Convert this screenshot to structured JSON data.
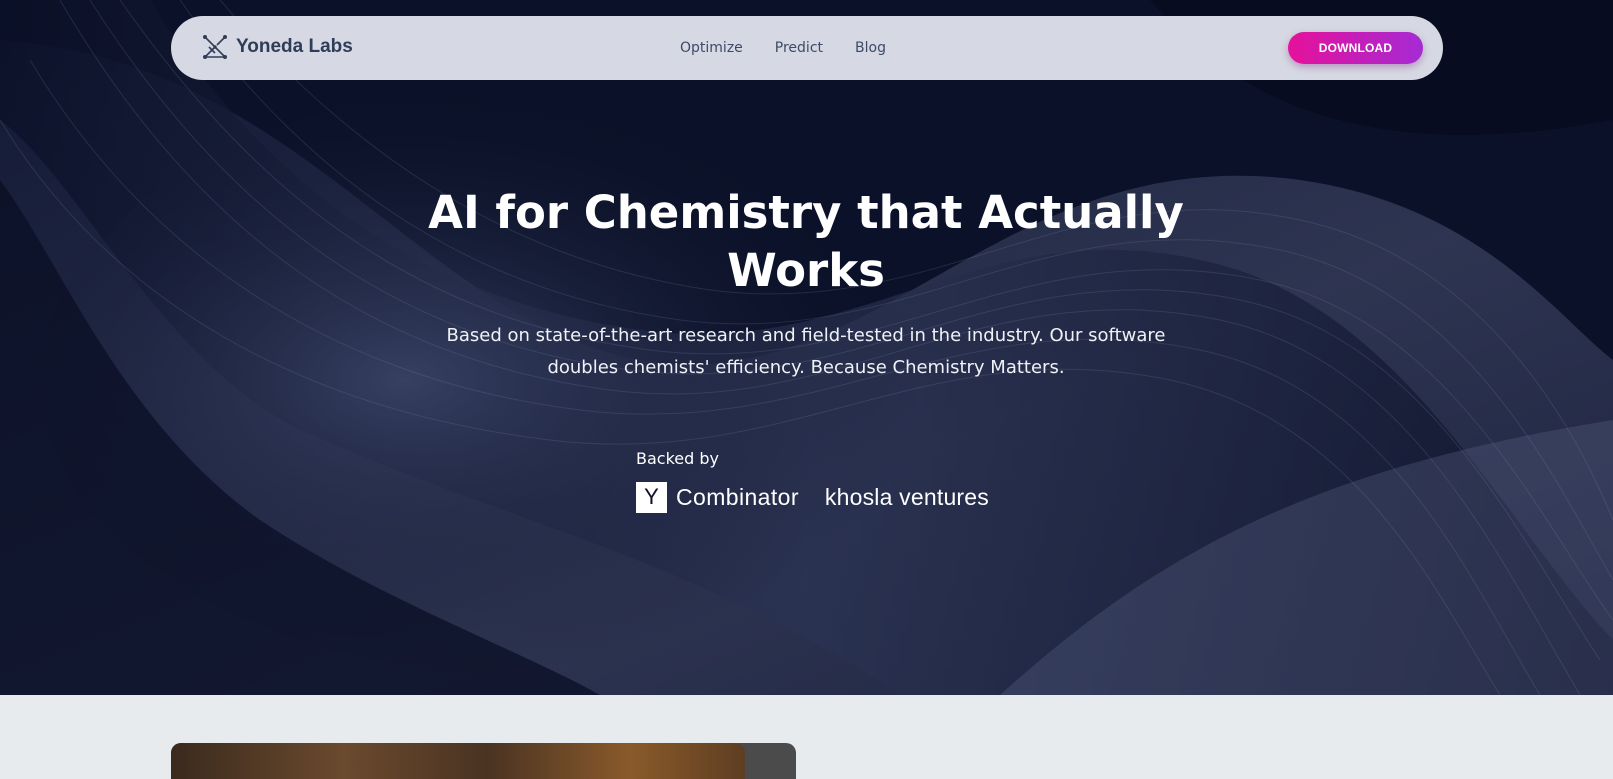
{
  "brand": {
    "name": "Yoneda Labs",
    "logo_icon": "graph-network-icon"
  },
  "nav": {
    "links": [
      {
        "label": "Optimize"
      },
      {
        "label": "Predict"
      },
      {
        "label": "Blog"
      }
    ],
    "download_label": "DOWNLOAD"
  },
  "hero": {
    "title": "AI for Chemistry that Actually Works",
    "subtitle": "Based on state-of-the-art research and field-tested in the industry. Our software doubles chemists' efficiency. Because Chemistry Matters.",
    "backed_by_label": "Backed by",
    "backers": {
      "yc_letter": "Y",
      "yc_name": "Combinator",
      "khosla_name": "khosla ventures"
    }
  },
  "colors": {
    "hero_background": "#0b1128",
    "accent_gradient_start": "#e5119a",
    "accent_gradient_end": "#a52bd4",
    "nav_background": "#d6d9e3",
    "section_background": "#e8ebee"
  }
}
